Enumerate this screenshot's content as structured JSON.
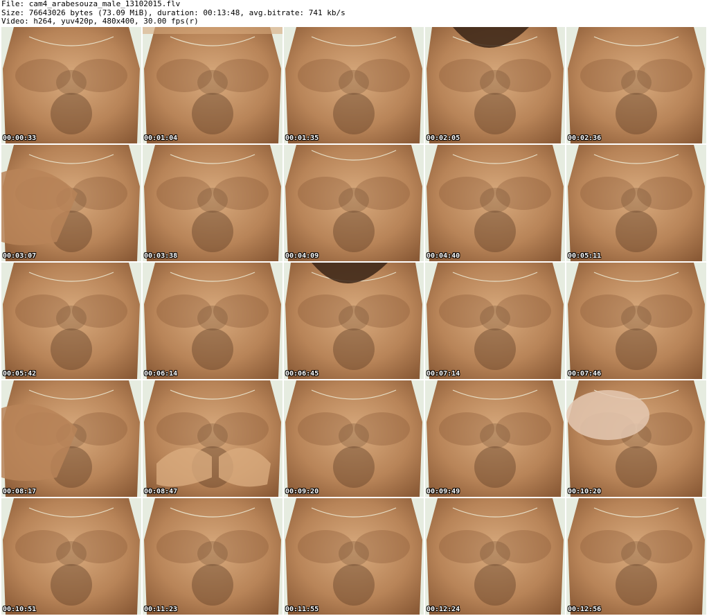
{
  "header": {
    "file_line": "File: cam4_arabesouza_male_13102015.flv",
    "size_line": "Size: 76643026 bytes (73.09 MiB), duration: 00:13:48, avg.bitrate: 741 kb/s",
    "video_line": "Video: h264, yuv420p, 480x400, 30.00 fps(r)"
  },
  "thumbnails": [
    {
      "timestamp": "00:00:33"
    },
    {
      "timestamp": "00:01:04"
    },
    {
      "timestamp": "00:01:35"
    },
    {
      "timestamp": "00:02:05"
    },
    {
      "timestamp": "00:02:36"
    },
    {
      "timestamp": "00:03:07"
    },
    {
      "timestamp": "00:03:38"
    },
    {
      "timestamp": "00:04:09"
    },
    {
      "timestamp": "00:04:40"
    },
    {
      "timestamp": "00:05:11"
    },
    {
      "timestamp": "00:05:42"
    },
    {
      "timestamp": "00:06:14"
    },
    {
      "timestamp": "00:06:45"
    },
    {
      "timestamp": "00:07:14"
    },
    {
      "timestamp": "00:07:46"
    },
    {
      "timestamp": "00:08:17"
    },
    {
      "timestamp": "00:08:47"
    },
    {
      "timestamp": "00:09:20"
    },
    {
      "timestamp": "00:09:49"
    },
    {
      "timestamp": "00:10:20"
    },
    {
      "timestamp": "00:10:51"
    },
    {
      "timestamp": "00:11:23"
    },
    {
      "timestamp": "00:11:55"
    },
    {
      "timestamp": "00:12:24"
    },
    {
      "timestamp": "00:12:56"
    }
  ],
  "colors": {
    "skin_light": "#d9ab7e",
    "skin_mid": "#b88458",
    "skin_dark": "#8a5a36",
    "hair": "#5a3a22",
    "wall": "#e6ece0",
    "chain": "#e8e0c8"
  }
}
